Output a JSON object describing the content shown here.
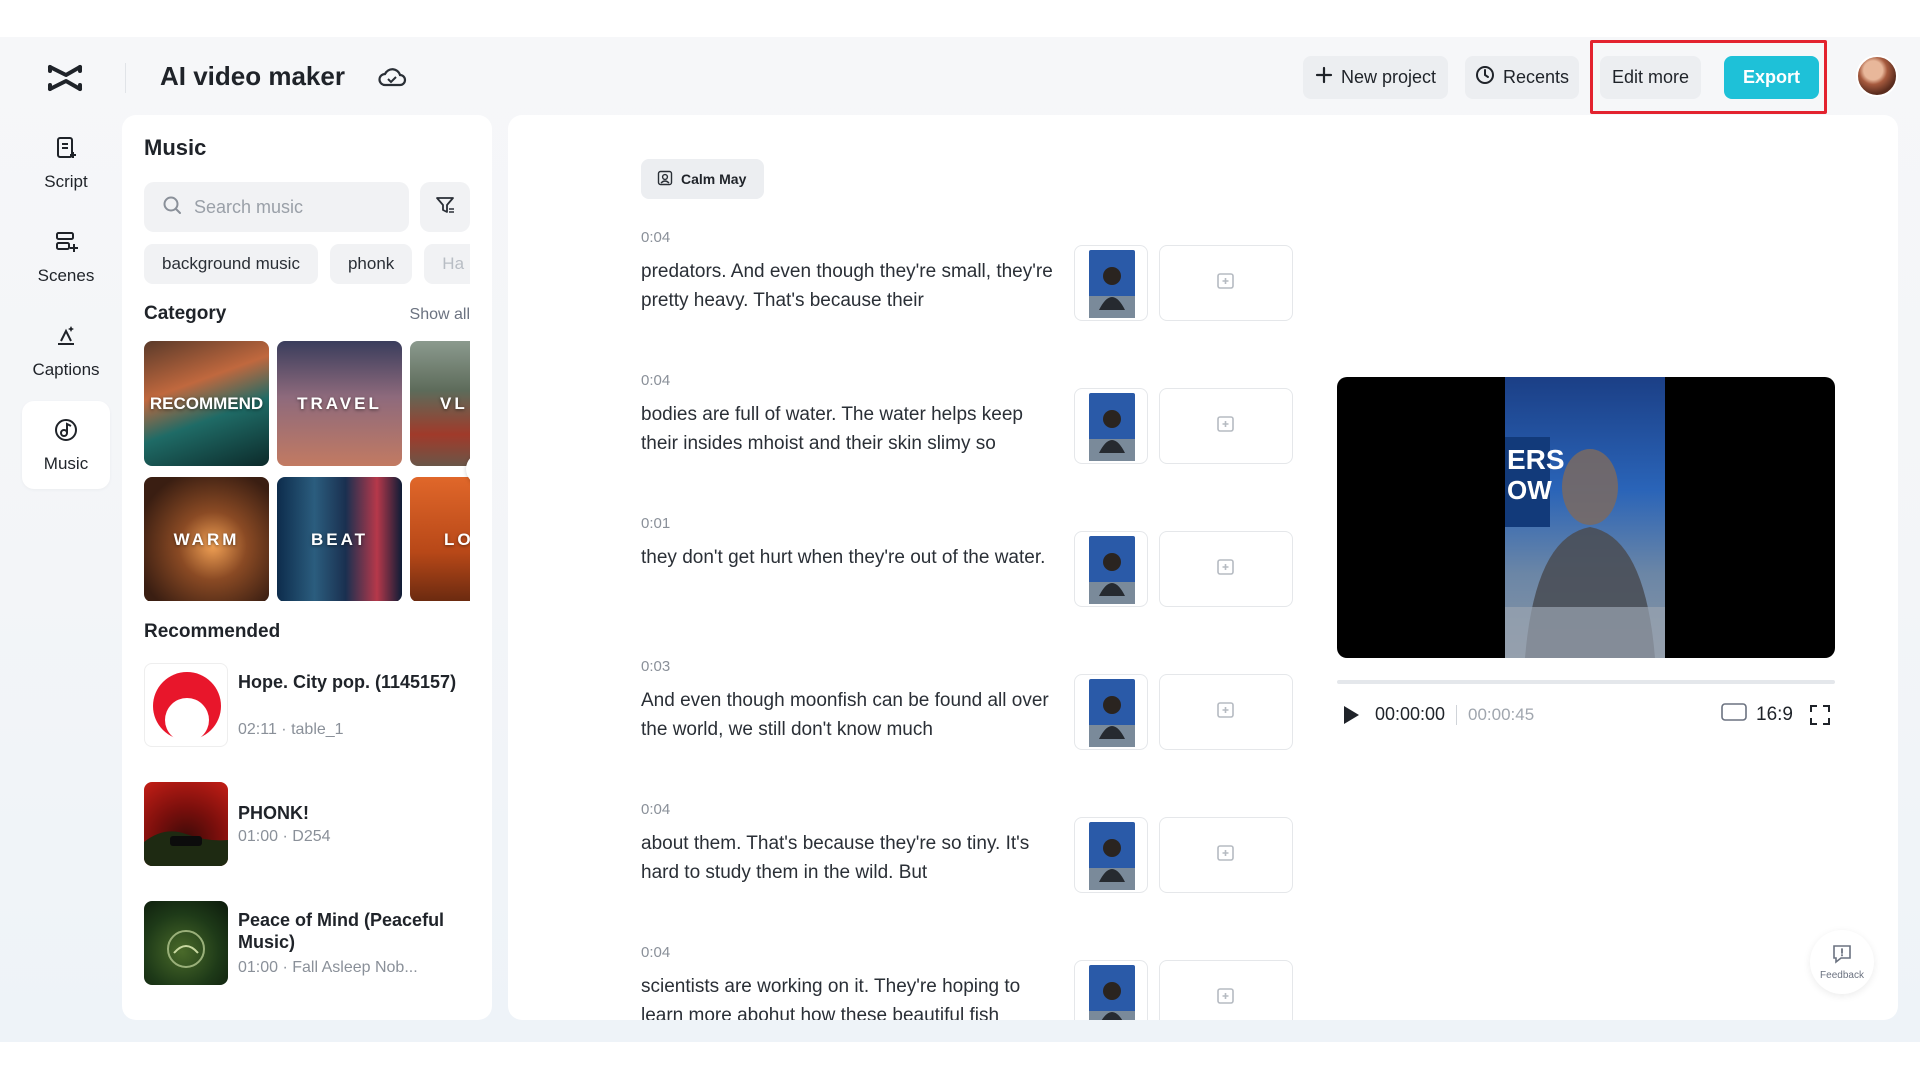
{
  "app": {
    "title": "AI video maker",
    "logo_icon": "capcut-logo-icon",
    "cloud_icon": "cloud-icon"
  },
  "toolbar": {
    "new_project": "New project",
    "recents": "Recents",
    "edit_more": "Edit more",
    "export": "Export",
    "export_color": "#1ec1d8",
    "highlight_color": "#e3232f"
  },
  "nav": {
    "items": [
      {
        "label": "Script",
        "icon": "script-icon"
      },
      {
        "label": "Scenes",
        "icon": "scenes-icon"
      },
      {
        "label": "Captions",
        "icon": "captions-icon"
      },
      {
        "label": "Music",
        "icon": "music-icon",
        "active": true
      }
    ]
  },
  "music": {
    "title": "Music",
    "search_placeholder": "Search music",
    "tags": [
      "background music",
      "phonk",
      "Ha"
    ],
    "category_label": "Category",
    "show_all": "Show all",
    "categories": [
      "RECOMMEND",
      "TRAVEL",
      "VL",
      "WARM",
      "BEAT",
      "LO"
    ],
    "recommended_label": "Recommended",
    "recommended": [
      {
        "title": "Hope. City pop. (1145157)",
        "meta": "02:11 · table_1"
      },
      {
        "title": "PHONK!",
        "meta": "01:00 · D254"
      },
      {
        "title": "Peace of Mind (Peaceful Music)",
        "meta": "01:00 · Fall Asleep Nob..."
      }
    ]
  },
  "script": {
    "speaker": "Calm May",
    "scenes": [
      {
        "duration": "0:04",
        "text": "predators. And even though they're small, they're pretty heavy. That's because their"
      },
      {
        "duration": "0:04",
        "text": "bodies are full of water. The water helps keep their insides mhoist and their skin slimy so"
      },
      {
        "duration": "0:01",
        "text": "they don't get hurt when they're out of the water."
      },
      {
        "duration": "0:03",
        "text": "And even though moonfish can be found all over the world, we still don't know much"
      },
      {
        "duration": "0:04",
        "text": "about them. That's because they're so tiny. It's hard to study them in the wild. But"
      },
      {
        "duration": "0:04",
        "text": "scientists are working on it. They're hoping to learn more abohut how these beautiful fish"
      }
    ]
  },
  "preview": {
    "current_time": "00:00:00",
    "total_time": "00:00:45",
    "aspect_ratio": "16:9",
    "progress": 0
  },
  "feedback": {
    "label": "Feedback"
  }
}
